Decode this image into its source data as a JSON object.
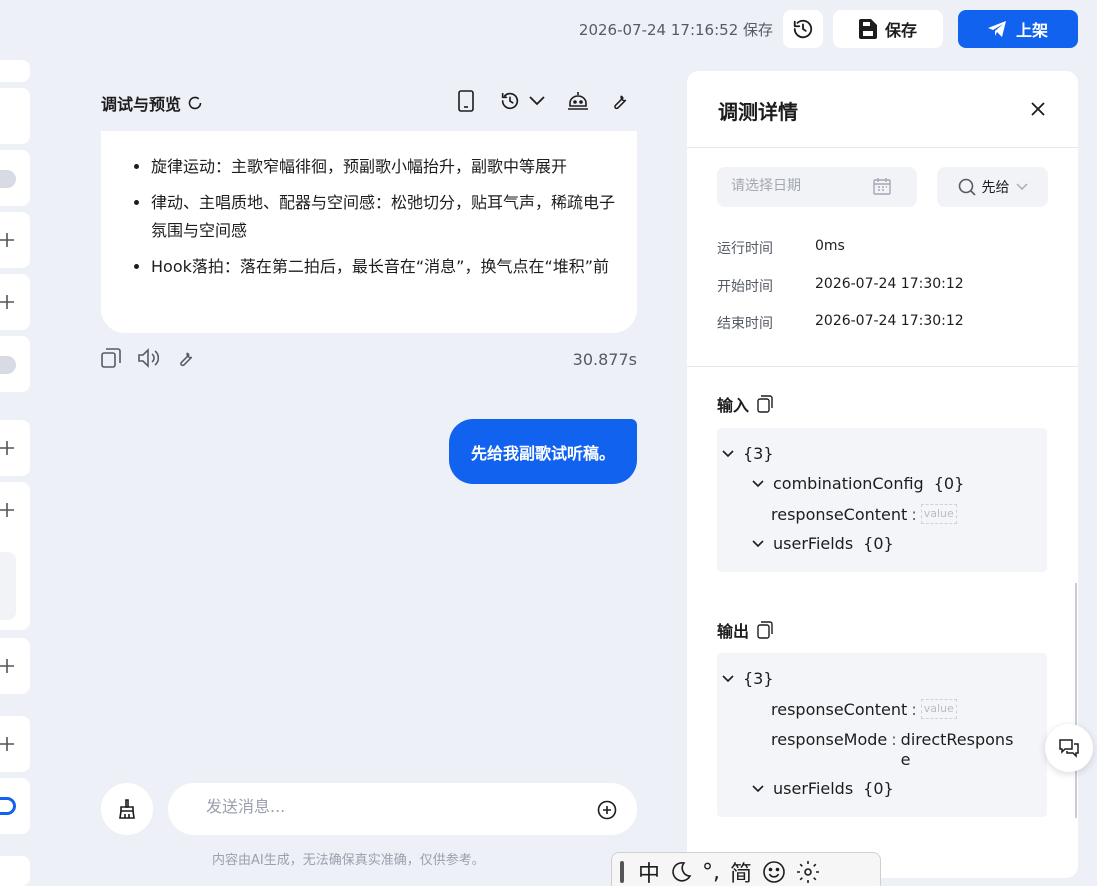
{
  "topbar": {
    "saved_time": "2026-07-24 17:16:52 保存",
    "save_label": "保存",
    "publish_label": "上架"
  },
  "preview": {
    "title": "调试与预览",
    "bullets": [
      "旋律运动：主歌窄幅徘徊，预副歌小幅抬升，副歌中等展开",
      "律动、主唱质地、配器与空间感：松弛切分，贴耳气声，稀疏电子氛围与空间感",
      "Hook落拍：落在第二拍后，最长音在“消息”，换气点在“堆积”前"
    ],
    "response_time": "30.877s",
    "user_message": "先给我副歌试听稿。",
    "input_placeholder": "发送消息...",
    "disclaimer": "内容由AI生成，无法确保真实准确，仅供参考。"
  },
  "details": {
    "title": "调测详情",
    "date_placeholder": "请选择日期",
    "search_value": "先给",
    "info": [
      {
        "key": "运行时间",
        "value": "0ms"
      },
      {
        "key": "开始时间",
        "value": "2026-07-24 17:30:12"
      },
      {
        "key": "结束时间",
        "value": "2026-07-24 17:30:12"
      }
    ],
    "input": {
      "title": "输入",
      "root": "{3}",
      "k1": "combinationConfig",
      "k1v": "{0}",
      "k2": "responseContent",
      "k3": "userFields",
      "k3v": "{0}",
      "placeholder_value": "value"
    },
    "output": {
      "title": "输出",
      "root": "{3}",
      "k1": "responseContent",
      "k2": "responseMode",
      "k2v": "directResponse",
      "k3": "userFields",
      "k3v": "{0}",
      "placeholder_value": "value"
    }
  },
  "ime": {
    "mode": "中",
    "simplified": "简"
  },
  "colors": {
    "primary": "#1262f0",
    "background": "#eef0f7"
  }
}
